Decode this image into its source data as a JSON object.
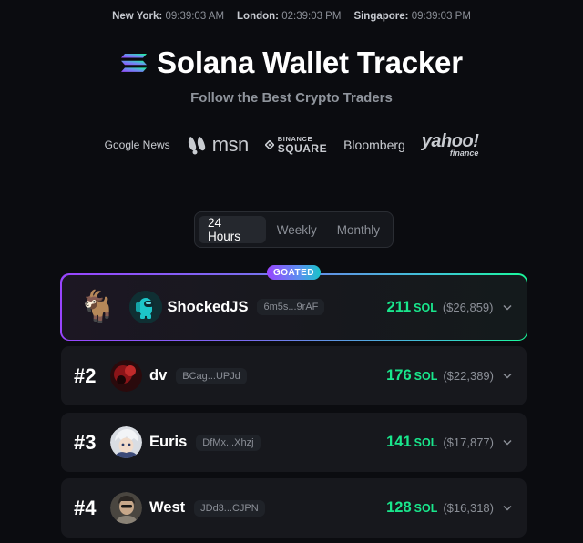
{
  "clocks": [
    {
      "city": "New York:",
      "time": "09:39:03 AM"
    },
    {
      "city": "London:",
      "time": "02:39:03 PM"
    },
    {
      "city": "Singapore:",
      "time": "09:39:03 PM"
    }
  ],
  "header": {
    "title": "Solana Wallet Tracker",
    "subtitle": "Follow the Best Crypto Traders",
    "logo_icon": "solana-logo"
  },
  "press": {
    "google_news": "Google News",
    "msn": "msn",
    "binance_top": "BINANCE",
    "binance_bottom": "SQUARE",
    "bloomberg": "Bloomberg",
    "yahoo_top": "yahoo!",
    "yahoo_bottom": "finance"
  },
  "tabs": [
    {
      "label": "24 Hours",
      "active": true
    },
    {
      "label": "Weekly",
      "active": false
    },
    {
      "label": "Monthly",
      "active": false
    }
  ],
  "leaderboard": {
    "goat_badge": "GOATED",
    "goat_emoji": "🐐",
    "rows": [
      {
        "rank": "",
        "name": "ShockedJS",
        "address": "6m5s...9rAF",
        "sol": "211",
        "sol_unit": "SOL",
        "usd": "($26,859)"
      },
      {
        "rank": "#2",
        "name": "dv",
        "address": "BCag...UPJd",
        "sol": "176",
        "sol_unit": "SOL",
        "usd": "($22,389)"
      },
      {
        "rank": "#3",
        "name": "Euris",
        "address": "DfMx...Xhzj",
        "sol": "141",
        "sol_unit": "SOL",
        "usd": "($17,877)"
      },
      {
        "rank": "#4",
        "name": "West",
        "address": "JDd3...CJPN",
        "sol": "128",
        "sol_unit": "SOL",
        "usd": "($16,318)"
      }
    ]
  },
  "colors": {
    "accent_green": "#19e68c",
    "solana_purple": "#9945ff",
    "solana_teal": "#19fb9b",
    "background": "#0b0c10"
  }
}
